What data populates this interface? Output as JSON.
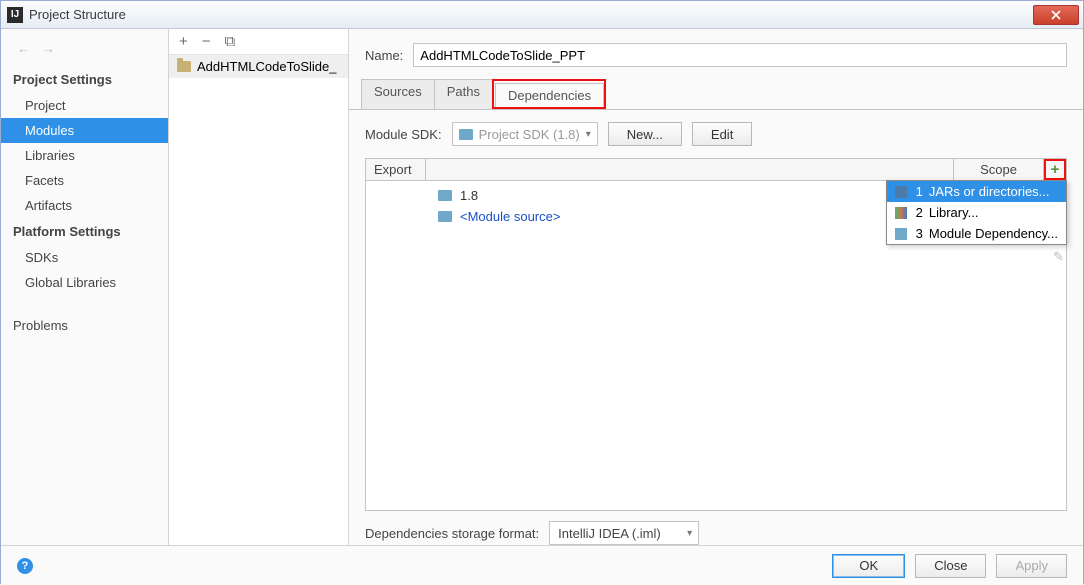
{
  "window": {
    "title": "Project Structure"
  },
  "sidebar": {
    "section1": "Project Settings",
    "items1": [
      "Project",
      "Modules",
      "Libraries",
      "Facets",
      "Artifacts"
    ],
    "selected1": 1,
    "section2": "Platform Settings",
    "items2": [
      "SDKs",
      "Global Libraries"
    ],
    "problems": "Problems"
  },
  "tree": {
    "module_name": "AddHTMLCodeToSlide_"
  },
  "name_field": {
    "label": "Name:",
    "value": "AddHTMLCodeToSlide_PPT"
  },
  "tabs": {
    "items": [
      "Sources",
      "Paths",
      "Dependencies"
    ],
    "active": 2
  },
  "sdk": {
    "label": "Module SDK:",
    "value": "Project SDK (1.8)",
    "new_btn": "New...",
    "edit_btn": "Edit"
  },
  "dep_table": {
    "col_export": "Export",
    "col_scope": "Scope",
    "rows": [
      {
        "label": "1.8",
        "kind": "sdk"
      },
      {
        "label": "<Module source>",
        "kind": "module"
      }
    ]
  },
  "popup": {
    "items": [
      {
        "n": "1",
        "label": "JARs or directories...",
        "icon": "jar"
      },
      {
        "n": "2",
        "label": "Library...",
        "icon": "lib"
      },
      {
        "n": "3",
        "label": "Module Dependency...",
        "icon": "mod"
      }
    ],
    "selected": 0
  },
  "storage": {
    "label": "Dependencies storage format:",
    "value": "IntelliJ IDEA (.iml)"
  },
  "buttons": {
    "ok": "OK",
    "cancel": "Close",
    "apply": "Apply"
  }
}
